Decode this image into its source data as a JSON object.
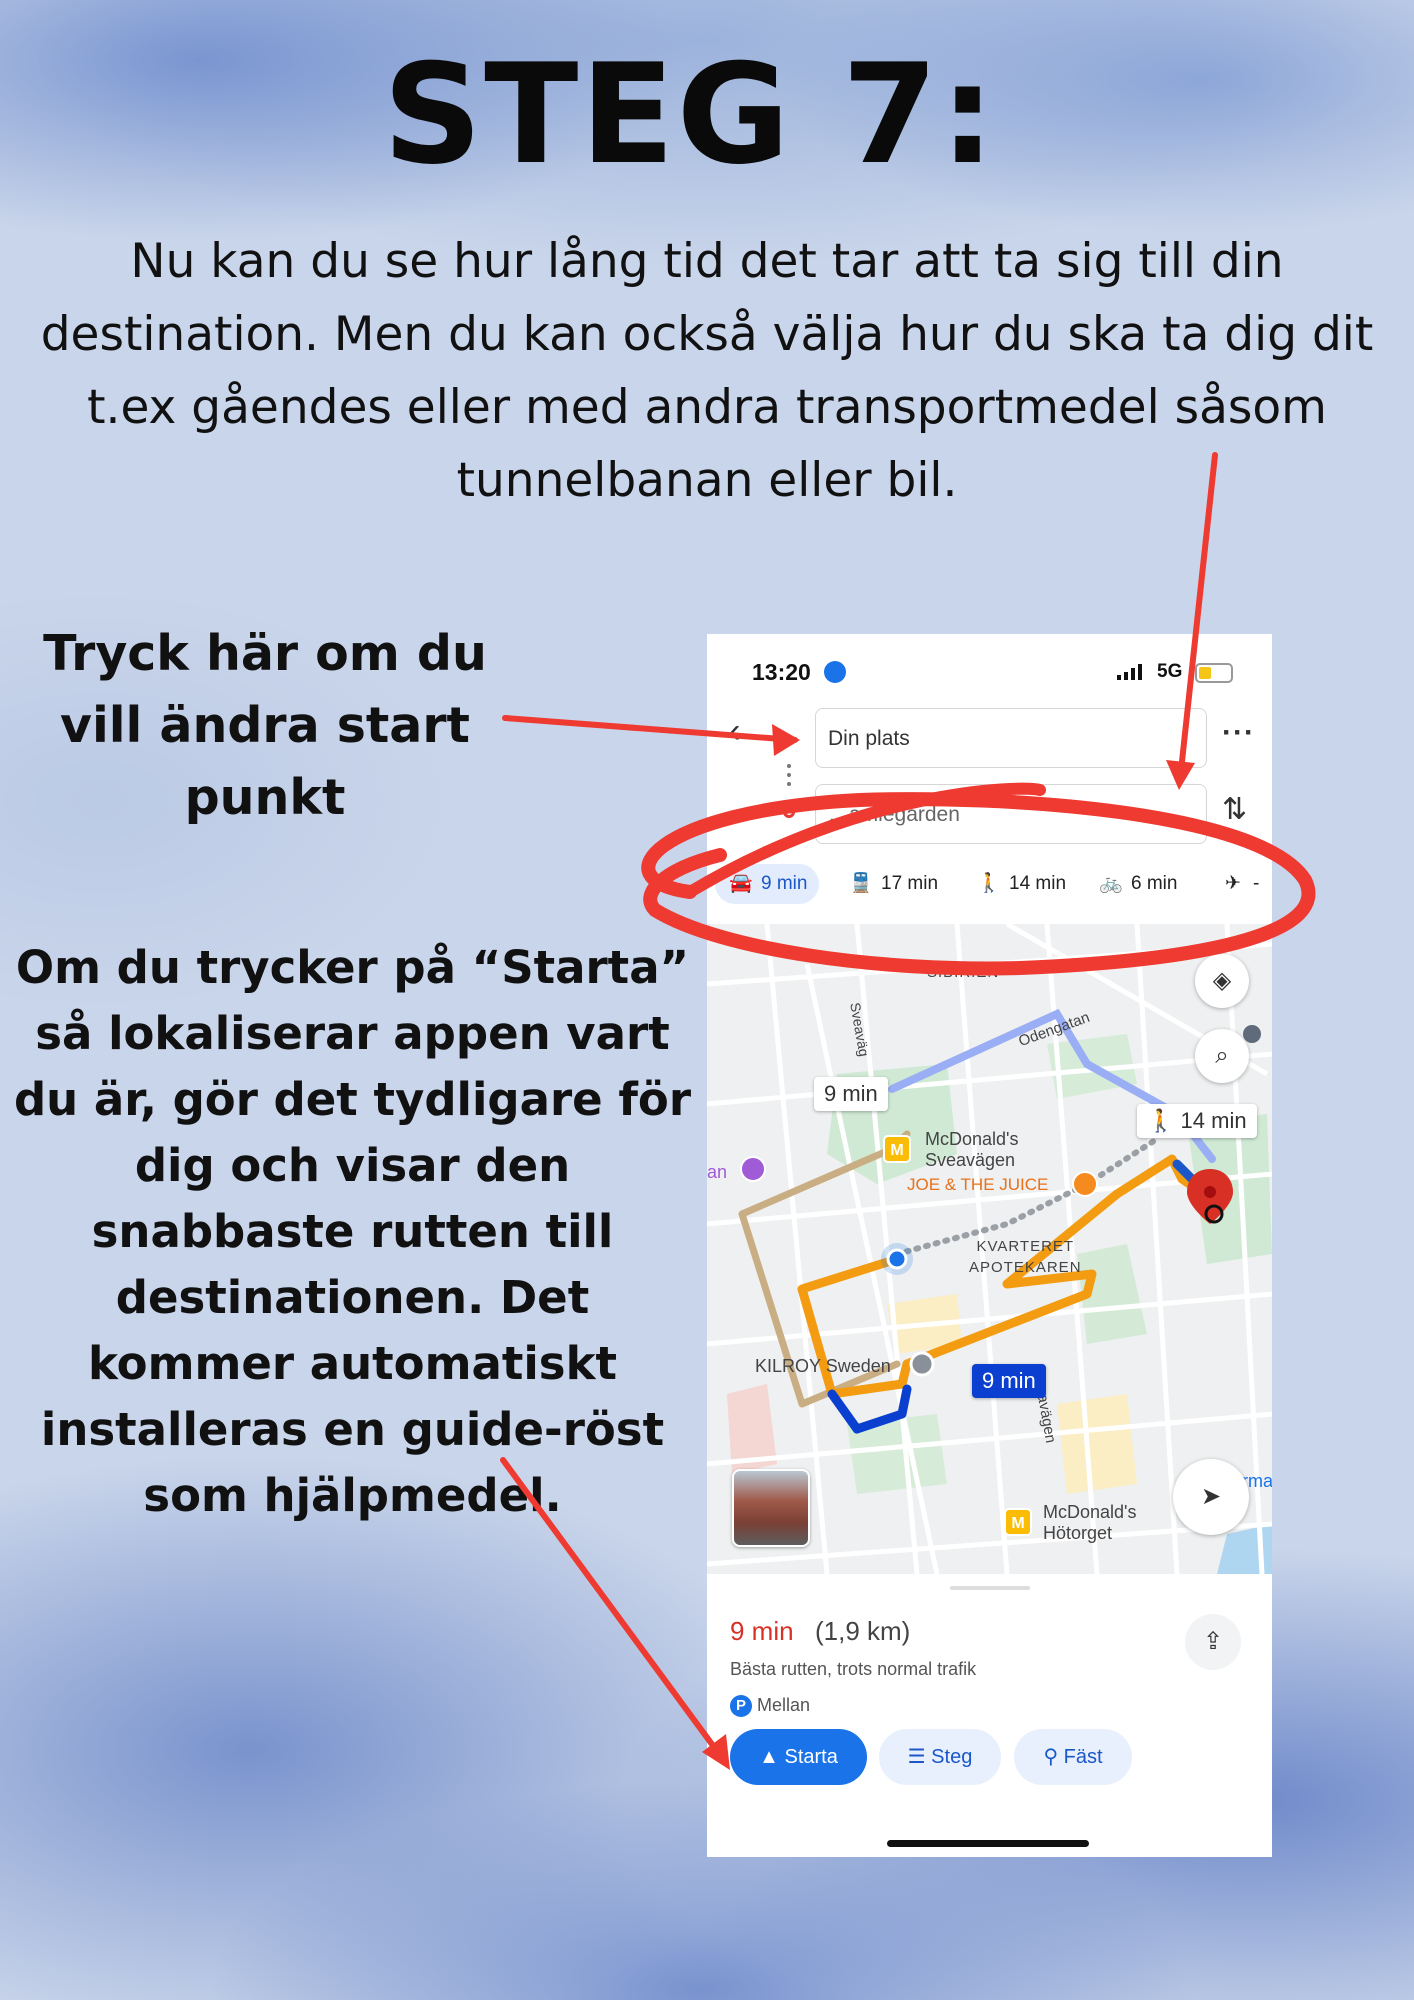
{
  "heading": "STEG 7:",
  "intro": "Nu kan du se hur lång tid det tar att ta sig till din destination. Men du kan också välja hur du ska ta dig dit t.ex gåendes eller med andra transportmedel såsom tunnelbanan eller bil.",
  "annotation_start": "Tryck här om du vill ändra start punkt",
  "annotation_starta": "Om du trycker på “Starta” så lokaliserar appen vart du är, gör det tydligare för dig och visar den snabbaste rutten till destinationen. Det kommer automatiskt installeras en guide-röst som hjälpmedel.",
  "colors": {
    "annotation_red": "#ee3a30",
    "primary_blue": "#1a73e8",
    "route_orange": "#f39c12",
    "route_blue": "#0b3fcf"
  },
  "phone": {
    "status": {
      "time": "13:20",
      "network": "5G"
    },
    "search": {
      "origin": "Din plats",
      "destination": "…amlegården"
    },
    "modes": [
      {
        "icon": "car-icon",
        "label": "9 min",
        "active": true
      },
      {
        "icon": "transit-icon",
        "label": "17 min"
      },
      {
        "icon": "walk-icon",
        "label": "14 min"
      },
      {
        "icon": "bike-icon",
        "label": "6 min"
      },
      {
        "icon": "flight-icon",
        "label": "-"
      }
    ],
    "map": {
      "labels": {
        "sibirien": "SIBIRIEN",
        "sveavagen_top": "Sveaväg",
        "odengatan": "Odengatan",
        "mcd1": "McDonald's\nSveavägen",
        "joe": "JOE & THE JUICE",
        "kvarteret": "KVARTERET\nAPOTEKAREN",
        "kilroy": "KILROY Sweden",
        "sveavagen_bottom": "eavägen",
        "mcd2": "McDonald's\nHötorget",
        "an": "an",
        "erma": "erma",
        "m_badge": "M"
      },
      "callouts": {
        "car": "9 min",
        "walk": "14 min",
        "route": "9 min"
      }
    },
    "sheet": {
      "duration": "9 min",
      "distance": "(1,9 km)",
      "best_route": "Bästa rutten, trots normal trafik",
      "parking_badge": "P",
      "parking": "Mellan",
      "buttons": {
        "start": "Starta",
        "steps": "Steg",
        "pin": "Fäst"
      }
    }
  }
}
